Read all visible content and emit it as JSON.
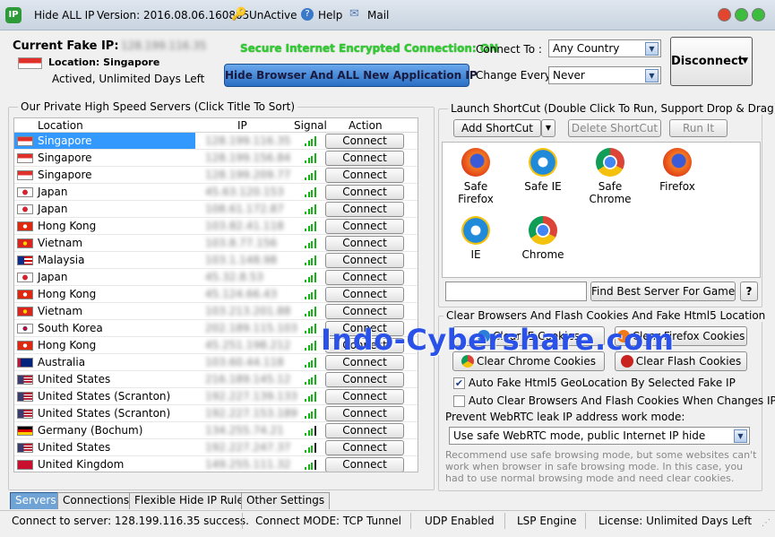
{
  "titlebar": {
    "app_name": "Hide ALL IP",
    "version": "Version: 2016.08.06.160805",
    "unactive": "UnActive",
    "help": "Help",
    "mail": "Mail"
  },
  "header": {
    "current_fake_ip_label": "Current Fake IP:",
    "current_fake_ip_value": "128.199.116.35",
    "location": "Location: Singapore",
    "activation": "Actived, Unlimited Days Left",
    "secure_text": "Secure Internet Encrypted Connection: ON",
    "hide_button": "Hide Browser And ALL New Application IP",
    "connect_to_label": "Connect To :",
    "connect_to_value": "Any Country",
    "change_every_label": "Change Every",
    "change_every_value": "Never",
    "disconnect_button": "Disconnect"
  },
  "servers": {
    "group_title": "Our Private High Speed Servers (Click Title To Sort)",
    "columns": {
      "location": "Location",
      "ip": "IP",
      "signal": "Signal",
      "action": "Action"
    },
    "connect_label": "Connect",
    "rows": [
      {
        "location": "Singapore",
        "ip": "128.199.116.35",
        "flag": "sg",
        "signal": 4
      },
      {
        "location": "Singapore",
        "ip": "128.199.156.84",
        "flag": "sg",
        "signal": 4
      },
      {
        "location": "Singapore",
        "ip": "128.199.209.77",
        "flag": "sg",
        "signal": 4
      },
      {
        "location": "Japan",
        "ip": "45.63.120.153",
        "flag": "jp",
        "signal": 4
      },
      {
        "location": "Japan",
        "ip": "108.61.172.87",
        "flag": "jp",
        "signal": 4
      },
      {
        "location": "Hong Kong",
        "ip": "103.82.41.118",
        "flag": "hk",
        "signal": 4
      },
      {
        "location": "Vietnam",
        "ip": "103.8.77.156",
        "flag": "vn",
        "signal": 4
      },
      {
        "location": "Malaysia",
        "ip": "103.1.148.98",
        "flag": "my",
        "signal": 4
      },
      {
        "location": "Japan",
        "ip": "45.32.8.53",
        "flag": "jp",
        "signal": 4
      },
      {
        "location": "Hong Kong",
        "ip": "45.124.66.43",
        "flag": "hk",
        "signal": 4
      },
      {
        "location": "Vietnam",
        "ip": "103.213.201.88",
        "flag": "vn",
        "signal": 4
      },
      {
        "location": "South Korea",
        "ip": "202.189.115.103",
        "flag": "kr",
        "signal": 4
      },
      {
        "location": "Hong Kong",
        "ip": "45.251.198.212",
        "flag": "hk",
        "signal": 4
      },
      {
        "location": "Australia",
        "ip": "103.60.44.118",
        "flag": "au",
        "signal": 4
      },
      {
        "location": "United States",
        "ip": "216.189.145.12",
        "flag": "us",
        "signal": 4
      },
      {
        "location": "United States (Scranton)",
        "ip": "192.227.139.133",
        "flag": "us",
        "signal": 4
      },
      {
        "location": "United States (Scranton)",
        "ip": "192.227.153.189",
        "flag": "us",
        "signal": 4
      },
      {
        "location": "Germany (Bochum)",
        "ip": "134.255.74.21",
        "flag": "de",
        "signal": 3
      },
      {
        "location": "United States",
        "ip": "192.227.247.37",
        "flag": "us",
        "signal": 3
      },
      {
        "location": "United Kingdom",
        "ip": "149.255.111.32",
        "flag": "gb",
        "signal": 3
      }
    ]
  },
  "shortcuts": {
    "group_title": "Launch ShortCut (Double Click To Run, Support Drop & Drag)",
    "add_button": "Add ShortCut",
    "delete_button": "Delete ShortCut",
    "run_button": "Run It",
    "items": [
      {
        "label": "Safe Firefox",
        "icon": "firefox-icon"
      },
      {
        "label": "Safe IE",
        "icon": "ie-icon"
      },
      {
        "label": "Safe Chrome",
        "icon": "chrome-icon"
      },
      {
        "label": "Firefox",
        "icon": "firefox-icon"
      },
      {
        "label": "IE",
        "icon": "ie-icon"
      },
      {
        "label": "Chrome",
        "icon": "chrome-icon"
      }
    ],
    "find_placeholder": "",
    "find_button": "Find Best Server For Game",
    "help_button": "?"
  },
  "cookies": {
    "group_title": "Clear Browsers And Flash Cookies And Fake Html5 Location",
    "clear_ie": "Clear IE Cookies",
    "clear_firefox": "Clear Firefox Cookies",
    "clear_chrome": "Clear Chrome Cookies",
    "clear_flash": "Clear Flash Cookies",
    "auto_fake_html5": "Auto Fake Html5 GeoLocation By Selected Fake IP",
    "auto_clear": "Auto Clear Browsers And Flash Cookies When Changes IP",
    "webrtc_label": "Prevent WebRTC leak IP address work mode:",
    "webrtc_value": "Use safe WebRTC mode, public Internet IP hide",
    "note": "Recommend use safe browsing mode, but some websites can't work when browser in safe browsing mode. In this case, you had to use normal browsing mode and need clear cookies."
  },
  "watermark": "Indo-Cybershare.com",
  "tabs": [
    "Servers",
    "Connections",
    "Flexible Hide IP Rules",
    "Other Settings"
  ],
  "status": {
    "connect": "Connect to server: 128.199.116.35 success.",
    "mode": "Connect MODE: TCP Tunnel",
    "udp": "UDP Enabled",
    "lsp": "LSP Engine",
    "license": "License: Unlimited Days Left"
  }
}
